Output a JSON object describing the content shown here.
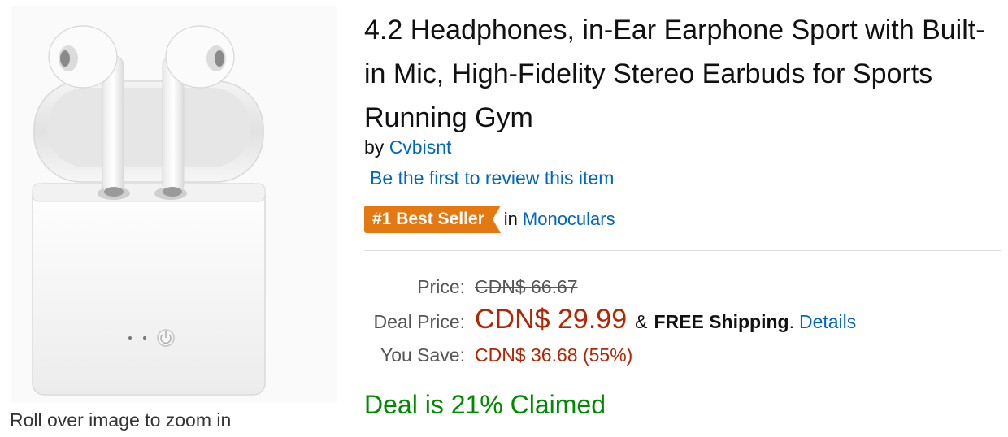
{
  "image": {
    "zoom_hint": "Roll over image to zoom in"
  },
  "product": {
    "title": "4.2 Headphones, in-Ear Earphone Sport with Built-in Mic, High-Fidelity Stereo Earbuds for Sports Running Gym",
    "by_prefix": "by",
    "brand": "Cvbisnt",
    "review_link": "Be the first to review this item"
  },
  "bestseller": {
    "badge": "#1 Best Seller",
    "in_text": "in",
    "category": "Monoculars"
  },
  "pricing": {
    "price_label": "Price:",
    "list_price": "CDN$ 66.67",
    "deal_label": "Deal Price:",
    "deal_price": "CDN$ 29.99",
    "amp": "&",
    "free_shipping": "FREE Shipping",
    "dot": ".",
    "details_link": "Details",
    "save_label": "You Save:",
    "savings": "CDN$ 36.68 (55%)"
  },
  "deal": {
    "claimed_text": "Deal is 21% Claimed"
  },
  "colors": {
    "link": "#0066c0",
    "deal_price": "#b12704",
    "badge": "#e47911",
    "claimed": "#008a00"
  }
}
